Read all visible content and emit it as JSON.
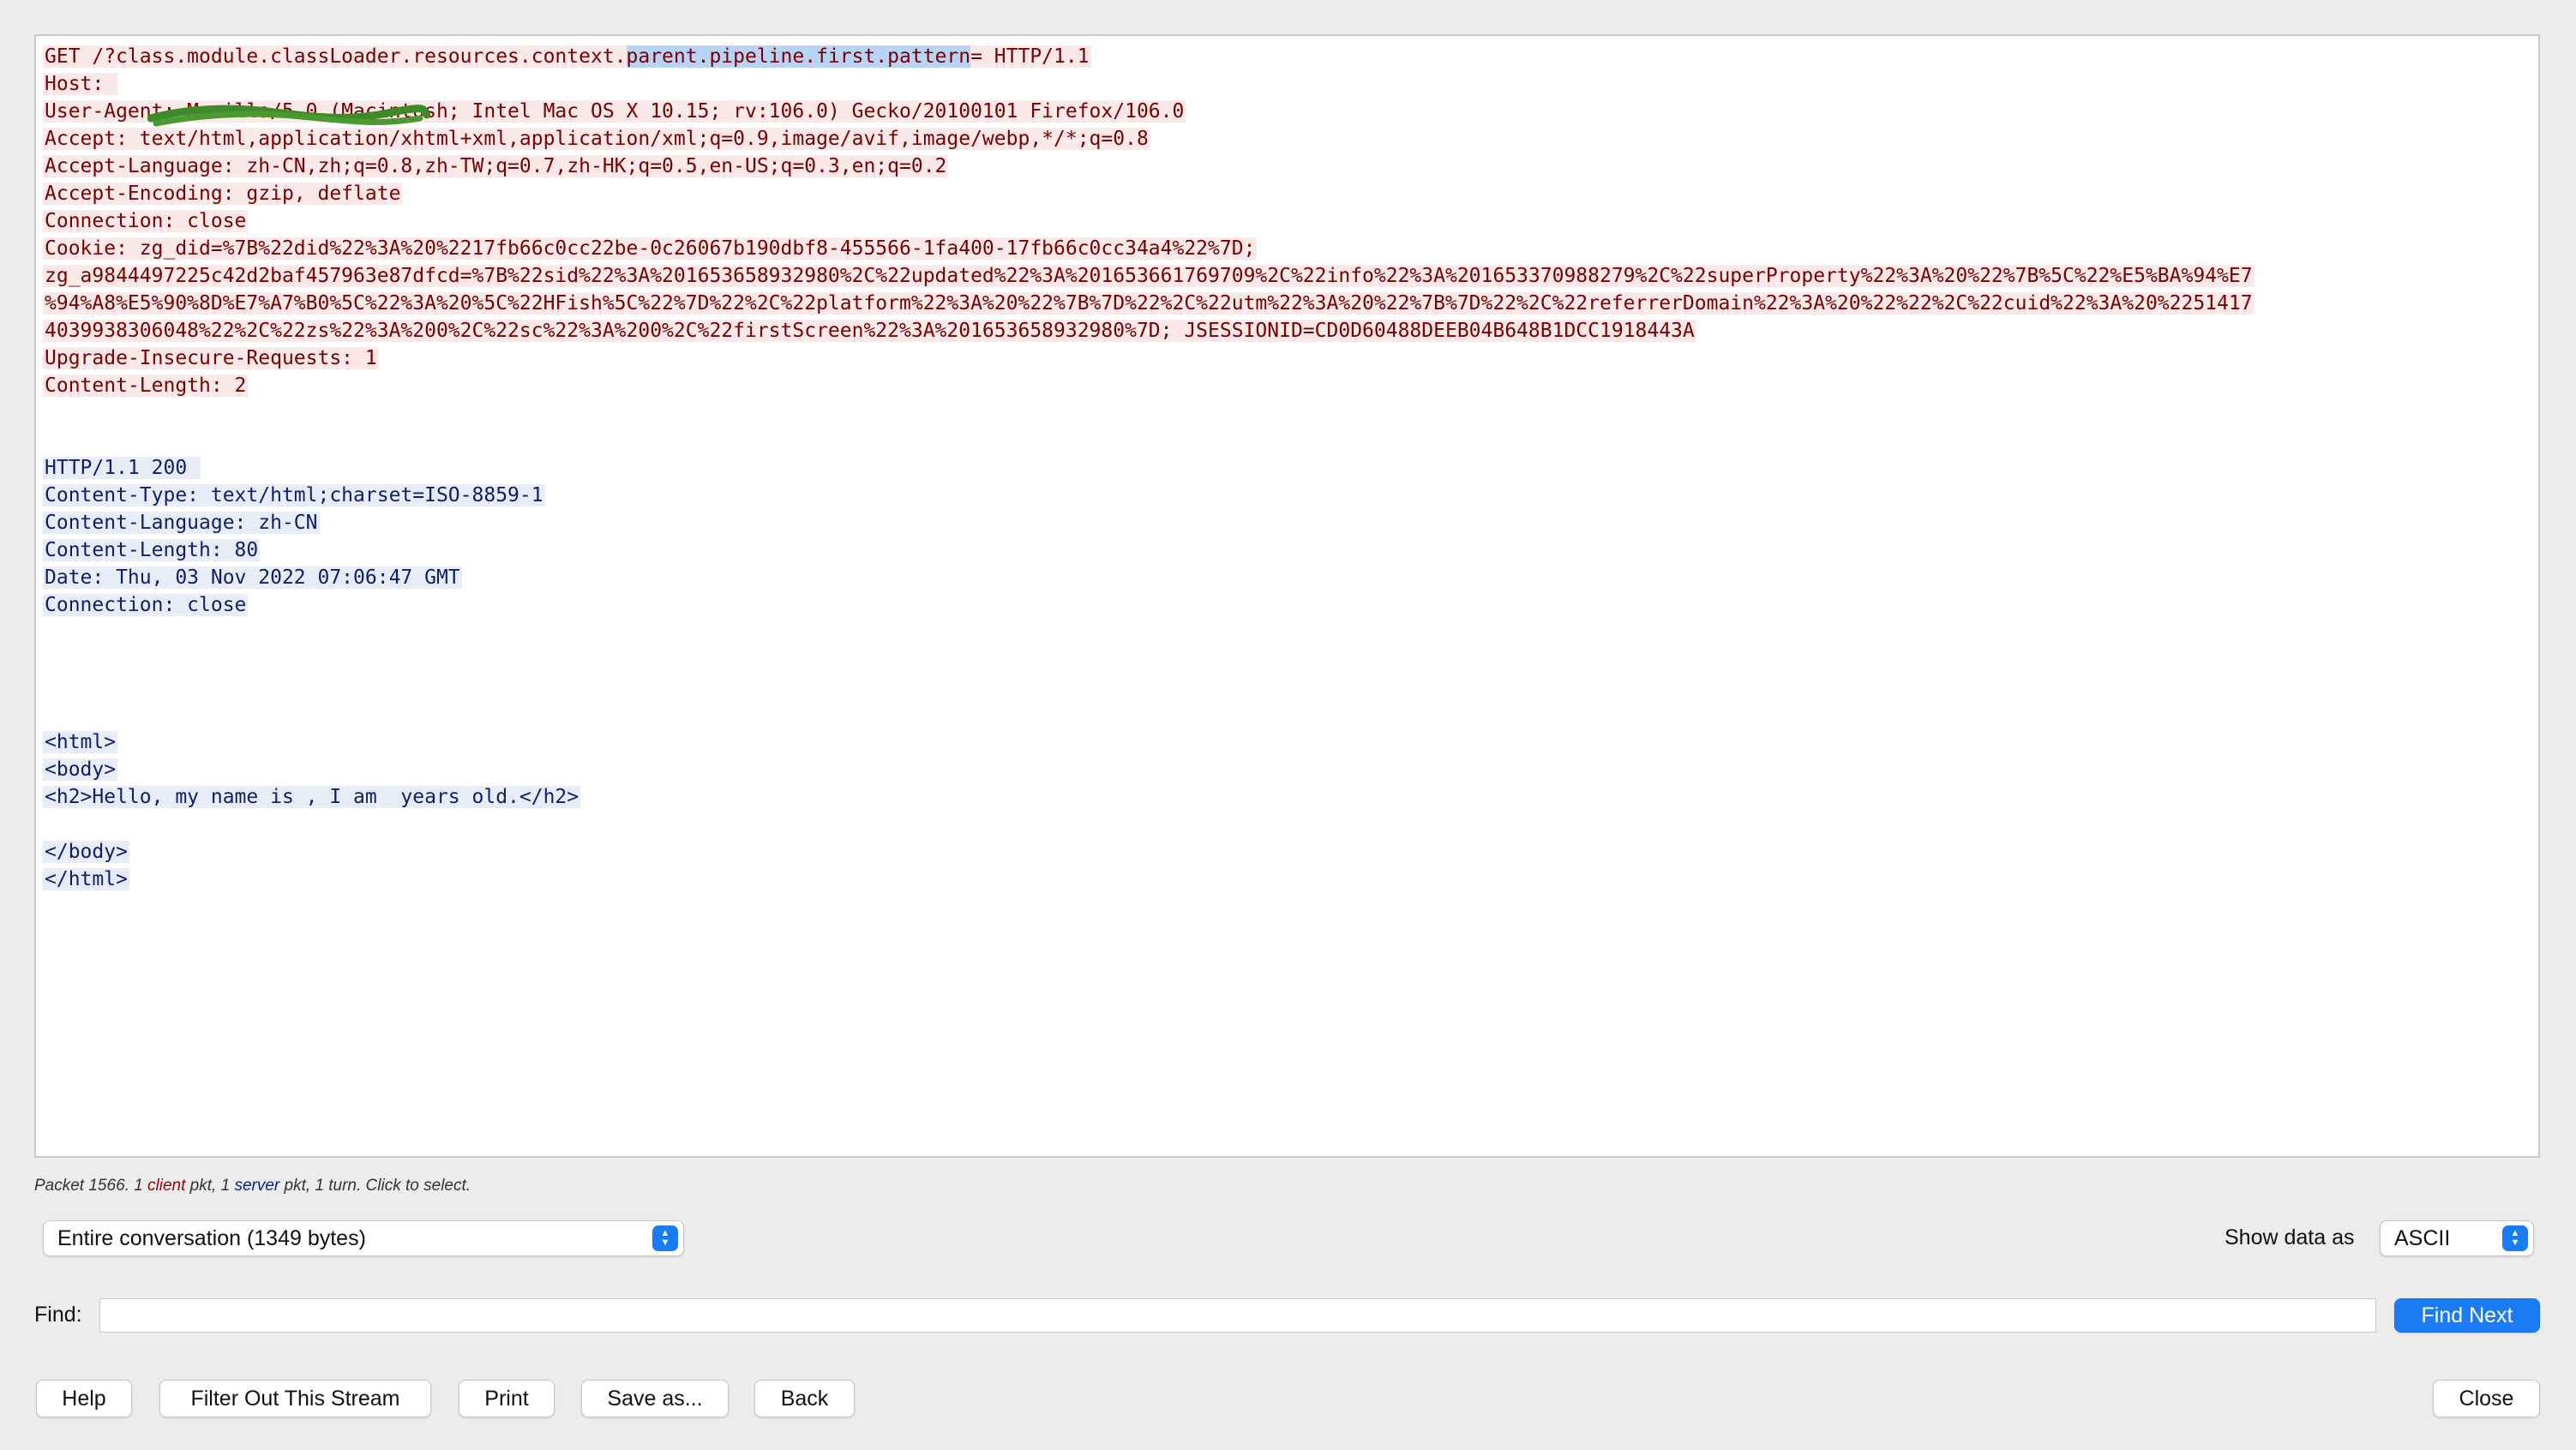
{
  "stream": {
    "request_lines": [
      "GET /?class.module.classLoader.resources.context.",
      "parent.pipeline.first.pattern",
      "= HTTP/1.1",
      "Host: ",
      "User-Agent: Mozilla/5.0 (Macintosh; Intel Mac OS X 10.15; rv:106.0) Gecko/20100101 Firefox/106.0",
      "Accept: text/html,application/xhtml+xml,application/xml;q=0.9,image/avif,image/webp,*/*;q=0.8",
      "Accept-Language: zh-CN,zh;q=0.8,zh-TW;q=0.7,zh-HK;q=0.5,en-US;q=0.3,en;q=0.2",
      "Accept-Encoding: gzip, deflate",
      "Connection: close",
      "Cookie: zg_did=%7B%22did%22%3A%20%2217fb66c0cc22be-0c26067b190dbf8-455566-1fa400-17fb66c0cc34a4%22%7D;",
      "zg_a9844497225c42d2baf457963e87dfcd=%7B%22sid%22%3A%201653658932980%2C%22updated%22%3A%201653661769709%2C%22info%22%3A%201653370988279%2C%22superProperty%22%3A%20%22%7B%5C%22%E5%BA%94%E7",
      "%94%A8%E5%90%8D%E7%A7%B0%5C%22%3A%20%5C%22HFish%5C%22%7D%22%2C%22platform%22%3A%20%22%7B%7D%22%2C%22utm%22%3A%20%22%7B%7D%22%2C%22referrerDomain%22%3A%20%22%22%2C%22cuid%22%3A%20%2251417",
      "4039938306048%22%2C%22zs%22%3A%200%2C%22sc%22%3A%200%2C%22firstScreen%22%3A%201653658932980%7D; JSESSIONID=CD0D60488DEEB04B648B1DCC1918443A",
      "Upgrade-Insecure-Requests: 1",
      "Content-Length: 2"
    ],
    "response_lines": [
      "HTTP/1.1 200 ",
      "Content-Type: text/html;charset=ISO-8859-1",
      "Content-Language: zh-CN",
      "Content-Length: 80",
      "Date: Thu, 03 Nov 2022 07:06:47 GMT",
      "Connection: close"
    ],
    "body_lines": [
      "<html>",
      "<body>",
      "<h2>Hello, my name is , I am  years old.</h2>",
      "</body>",
      "</html>"
    ]
  },
  "status": {
    "prefix": "Packet 1566. 1 ",
    "client_word": "client",
    "middle": " pkt, 1 ",
    "server_word": "server",
    "suffix": " pkt, 1 turn. Click to select."
  },
  "conversation_select": "Entire conversation (1349 bytes)",
  "show_data_label": "Show data as",
  "show_data_value": "ASCII",
  "find_label": "Find:",
  "find_value": "",
  "buttons": {
    "find_next": "Find Next",
    "help": "Help",
    "filter_out": "Filter Out This Stream",
    "print": "Print",
    "save_as": "Save as...",
    "back": "Back",
    "close": "Close"
  },
  "colors": {
    "client_text": "#7a0000",
    "client_bg": "#fbe9e9",
    "server_text": "#0d1f6b",
    "server_bg": "#e8ecf7",
    "selection": "#b7d3f6",
    "accent": "#1a7cf5"
  }
}
